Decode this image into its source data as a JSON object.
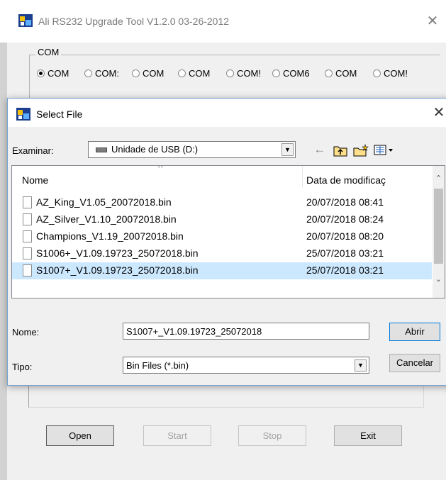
{
  "main_window": {
    "title": "Ali RS232 Upgrade Tool  V1.2.0 03-26-2012",
    "close_glyph": "✕",
    "com_group": {
      "legend": "COM",
      "ports": [
        {
          "label": "COM",
          "selected": true
        },
        {
          "label": "COM:",
          "selected": false
        },
        {
          "label": "COM",
          "selected": false
        },
        {
          "label": "COM",
          "selected": false
        },
        {
          "label": "COM!",
          "selected": false
        },
        {
          "label": "COM6",
          "selected": false
        },
        {
          "label": "COM",
          "selected": false
        },
        {
          "label": "COM!",
          "selected": false
        }
      ]
    },
    "buttons": {
      "open": "Open",
      "start": "Start",
      "stop": "Stop",
      "exit": "Exit"
    }
  },
  "dialog": {
    "title": "Select File",
    "close_glyph": "✕",
    "look_in_label": "Examinar:",
    "look_in_value": "Unidade de USB (D:)",
    "icons": [
      "back-arrow-icon",
      "up-folder-icon",
      "new-folder-icon",
      "view-menu-icon"
    ],
    "columns": {
      "name": "Nome",
      "date": "Data de modificaç"
    },
    "files": [
      {
        "name": "AZ_King_V1.05_20072018.bin",
        "date": "20/07/2018 08:41",
        "selected": false
      },
      {
        "name": "AZ_Silver_V1.10_20072018.bin",
        "date": "20/07/2018 08:24",
        "selected": false
      },
      {
        "name": "Champions_V1.19_20072018.bin",
        "date": "20/07/2018 08:20",
        "selected": false
      },
      {
        "name": "S1006+_V1.09.19723_25072018.bin",
        "date": "25/07/2018 03:21",
        "selected": false
      },
      {
        "name": "S1007+_V1.09.19723_25072018.bin",
        "date": "25/07/2018 03:21",
        "selected": true
      }
    ],
    "filename_label": "Nome:",
    "filename_value": "S1007+_V1.09.19723_25072018",
    "filetype_label": "Tipo:",
    "filetype_value": "Bin Files (*.bin)",
    "open_button": "Abrir",
    "cancel_button": "Cancelar"
  },
  "colors": {
    "selection": "#cce8ff",
    "dialog_border": "#6fa0d0",
    "default_button_border": "#0078d7"
  }
}
